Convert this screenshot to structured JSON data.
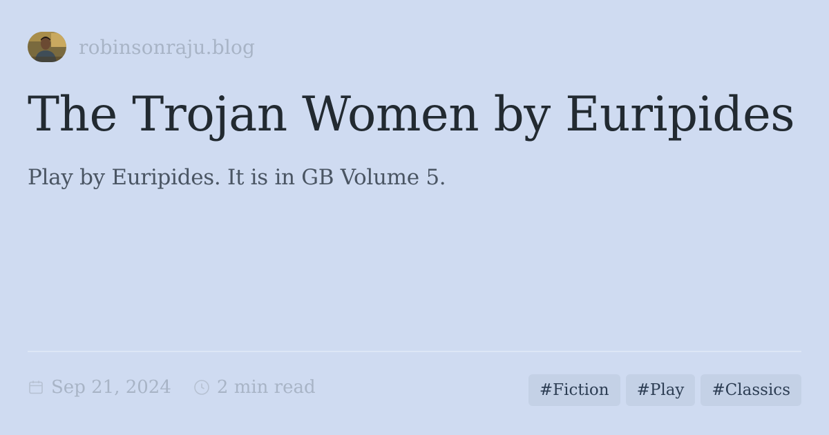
{
  "site": {
    "name": "robinsonraju.blog",
    "avatar_icon": "author-avatar"
  },
  "post": {
    "title": "The Trojan Women by Euripides",
    "subtitle": "Play by Euripides. It is in GB Volume 5."
  },
  "meta": {
    "date": "Sep 21, 2024",
    "date_icon": "calendar-icon",
    "read_time": "2 min read",
    "read_time_icon": "clock-icon"
  },
  "tags": [
    "#Fiction",
    "#Play",
    "#Classics"
  ],
  "colors": {
    "background": "#cfdbf1",
    "title": "#222a31",
    "subtitle": "#4a5563",
    "muted": "#a8b4c6",
    "tag_background": "#c4d1e6",
    "tag_text": "#2c3d53"
  }
}
